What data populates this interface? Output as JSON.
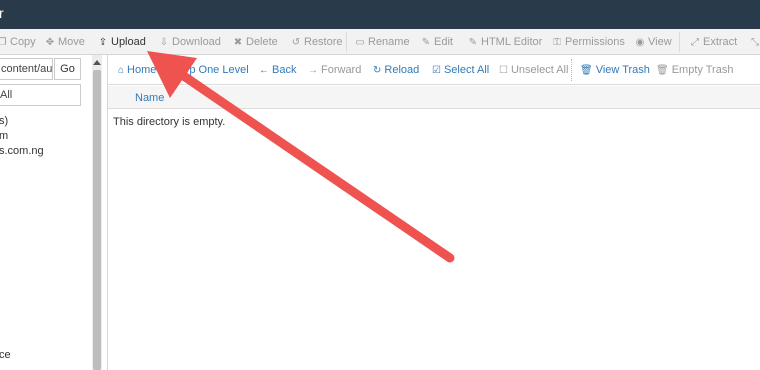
{
  "window": {
    "title": "r"
  },
  "toolbar": [
    {
      "label": "Copy",
      "icon": "copy-icon",
      "glyph": "❐",
      "active": false
    },
    {
      "label": "Move",
      "icon": "move-icon",
      "glyph": "✥",
      "active": false
    },
    {
      "label": "Upload",
      "icon": "upload-icon",
      "glyph": "⇪",
      "active": true
    },
    {
      "label": "Download",
      "icon": "download-icon",
      "glyph": "⇩",
      "active": false
    },
    {
      "label": "Delete",
      "icon": "delete-icon",
      "glyph": "✖",
      "active": false
    },
    {
      "label": "Restore",
      "icon": "restore-icon",
      "glyph": "↺",
      "active": false
    },
    {
      "label": "Rename",
      "icon": "rename-icon",
      "glyph": "▭",
      "active": false
    },
    {
      "label": "Edit",
      "icon": "edit-icon",
      "glyph": "✎",
      "active": false
    },
    {
      "label": "HTML Editor",
      "icon": "html-editor-icon",
      "glyph": "✎",
      "active": false
    },
    {
      "label": "Permissions",
      "icon": "permissions-icon",
      "glyph": "⚿",
      "active": false
    },
    {
      "label": "View",
      "icon": "view-icon",
      "glyph": "◉",
      "active": false
    },
    {
      "label": "Extract",
      "icon": "extract-icon",
      "glyph": "⤢",
      "active": false
    },
    {
      "label": "",
      "icon": "compress-icon",
      "glyph": "⤡",
      "active": false
    }
  ],
  "sidebar": {
    "path_value": "content/au",
    "go_label": "Go",
    "collapse_label": "All",
    "tree": [
      "s)",
      "m",
      "s.com.ng",
      "ce"
    ]
  },
  "nav": {
    "home": "Home",
    "up": "Up One Level",
    "back": "Back",
    "forward": "Forward",
    "reload": "Reload",
    "select_all": "Select All",
    "unselect_all": "Unselect All",
    "view_trash": "View Trash",
    "empty_trash": "Empty Trash"
  },
  "table": {
    "column_name": "Name",
    "empty_message": "This directory is empty."
  },
  "colors": {
    "titlebar": "#293a4a",
    "link": "#337ab7",
    "annotation_arrow": "#ef5350"
  }
}
